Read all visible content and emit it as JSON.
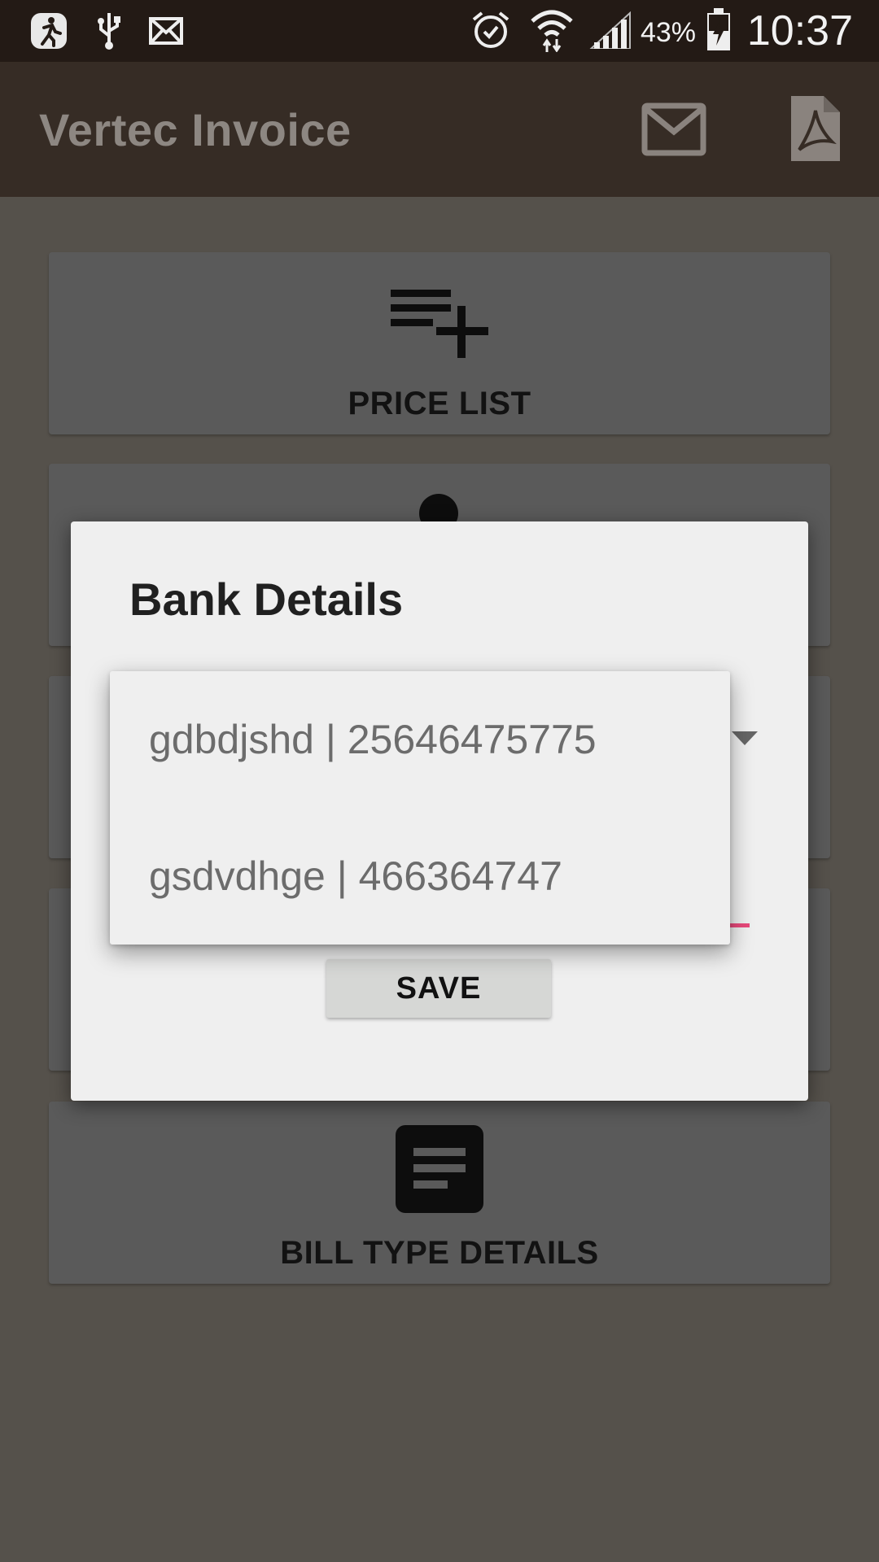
{
  "status_bar": {
    "battery_percent": "43%",
    "time": "10:37",
    "icons": [
      "running-app-icon",
      "usb-icon",
      "mail-icon",
      "alarm-icon",
      "wifi-icon",
      "signal-icon",
      "battery-charging-icon"
    ]
  },
  "app_bar": {
    "title": "Vertec Invoice",
    "actions": [
      "email-icon",
      "pdf-icon"
    ]
  },
  "cards": [
    {
      "label": "PRICE LIST",
      "icon": "playlist-add-icon"
    },
    {
      "label": "",
      "icon": "person-icon"
    },
    {
      "label": "",
      "icon": ""
    },
    {
      "label": "",
      "icon": ""
    },
    {
      "label": "BILL TYPE DETAILS",
      "icon": "description-icon"
    }
  ],
  "dialog": {
    "title": "Bank Details",
    "save_label": "SAVE",
    "dropdown_options": [
      "gdbdjshd | 25646475775",
      "gsdvdhge | 466364747"
    ]
  },
  "colors": {
    "status_bar": "#231a15",
    "app_bar": "#362c25",
    "scrim_background": "#55514b",
    "accent": "#e8497b",
    "dialog_bg": "#efefef"
  }
}
